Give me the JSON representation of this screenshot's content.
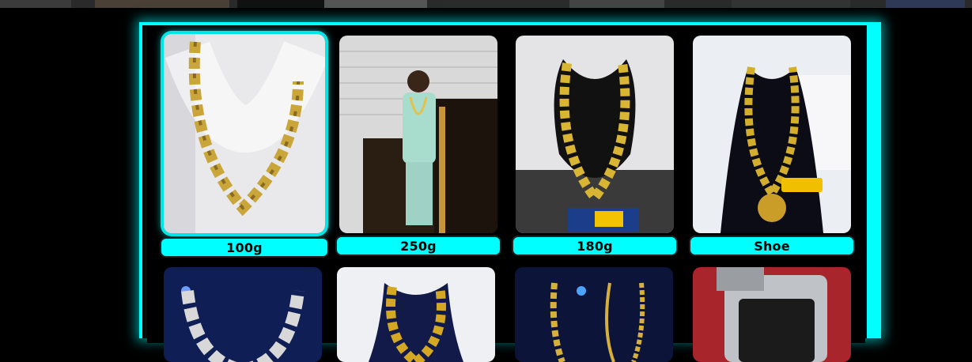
{
  "colors": {
    "accent": "#00ffff",
    "background": "#000000",
    "gold": "#d4b23a"
  },
  "gallery": {
    "items": [
      {
        "label": "100g",
        "selected": true,
        "image_icon": "gold-chain-photo-icon"
      },
      {
        "label": "250g",
        "selected": false,
        "image_icon": "person-with-chain-photo-icon"
      },
      {
        "label": "180g",
        "selected": false,
        "image_icon": "gold-chain-photo-icon"
      },
      {
        "label": "Shoe",
        "selected": false,
        "image_icon": "gold-chain-pendant-photo-icon"
      },
      {
        "label": "",
        "selected": false,
        "image_icon": "silver-chain-photo-icon"
      },
      {
        "label": "",
        "selected": false,
        "image_icon": "gold-chain-photo-icon"
      },
      {
        "label": "",
        "selected": false,
        "image_icon": "gold-chains-photo-icon"
      },
      {
        "label": "",
        "selected": false,
        "image_icon": "watch-photo-icon"
      }
    ]
  }
}
